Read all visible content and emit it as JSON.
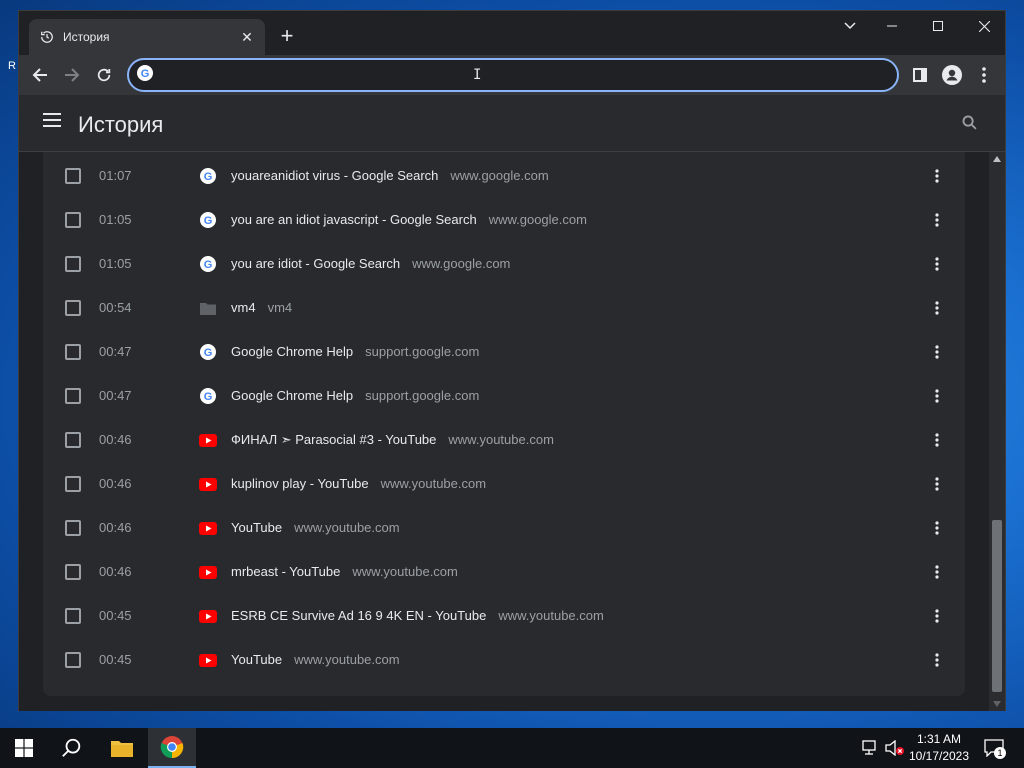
{
  "desktop": {
    "edge_letter": "R"
  },
  "browser": {
    "tab": {
      "title": "История"
    },
    "omnibox": {
      "value": "",
      "placeholder": ""
    }
  },
  "history": {
    "title": "История",
    "entries": [
      {
        "time": "01:07",
        "title": "youareanidiot virus - Google Search",
        "domain": "www.google.com",
        "favicon": "google-icon"
      },
      {
        "time": "01:05",
        "title": "you are an idiot javascript - Google Search",
        "domain": "www.google.com",
        "favicon": "google-icon"
      },
      {
        "time": "01:05",
        "title": "you are idiot - Google Search",
        "domain": "www.google.com",
        "favicon": "google-icon"
      },
      {
        "time": "00:54",
        "title": "vm4",
        "domain": "vm4",
        "favicon": "folder-icon"
      },
      {
        "time": "00:47",
        "title": "Google Chrome Help",
        "domain": "support.google.com",
        "favicon": "google-icon"
      },
      {
        "time": "00:47",
        "title": "Google Chrome Help",
        "domain": "support.google.com",
        "favicon": "google-icon"
      },
      {
        "time": "00:46",
        "title": "ФИНАЛ ➣ Parasocial #3 - YouTube",
        "domain": "www.youtube.com",
        "favicon": "youtube-icon"
      },
      {
        "time": "00:46",
        "title": "kuplinov play - YouTube",
        "domain": "www.youtube.com",
        "favicon": "youtube-icon"
      },
      {
        "time": "00:46",
        "title": "YouTube",
        "domain": "www.youtube.com",
        "favicon": "youtube-icon"
      },
      {
        "time": "00:46",
        "title": "mrbeast - YouTube",
        "domain": "www.youtube.com",
        "favicon": "youtube-icon"
      },
      {
        "time": "00:45",
        "title": "ESRB CE Survive Ad 16 9 4K EN - YouTube",
        "domain": "www.youtube.com",
        "favicon": "youtube-icon"
      },
      {
        "time": "00:45",
        "title": "YouTube",
        "domain": "www.youtube.com",
        "favicon": "youtube-icon"
      }
    ]
  },
  "taskbar": {
    "clock_time": "1:31 AM",
    "clock_date": "10/17/2023",
    "notification_count": "1"
  },
  "colors": {
    "window_bg": "#202124",
    "toolbar_bg": "#35363a",
    "card_bg": "#292a2d",
    "accent": "#8ab4f8",
    "text_primary": "#e8eaed",
    "text_secondary": "#9aa0a6",
    "youtube_red": "#ff0000"
  }
}
